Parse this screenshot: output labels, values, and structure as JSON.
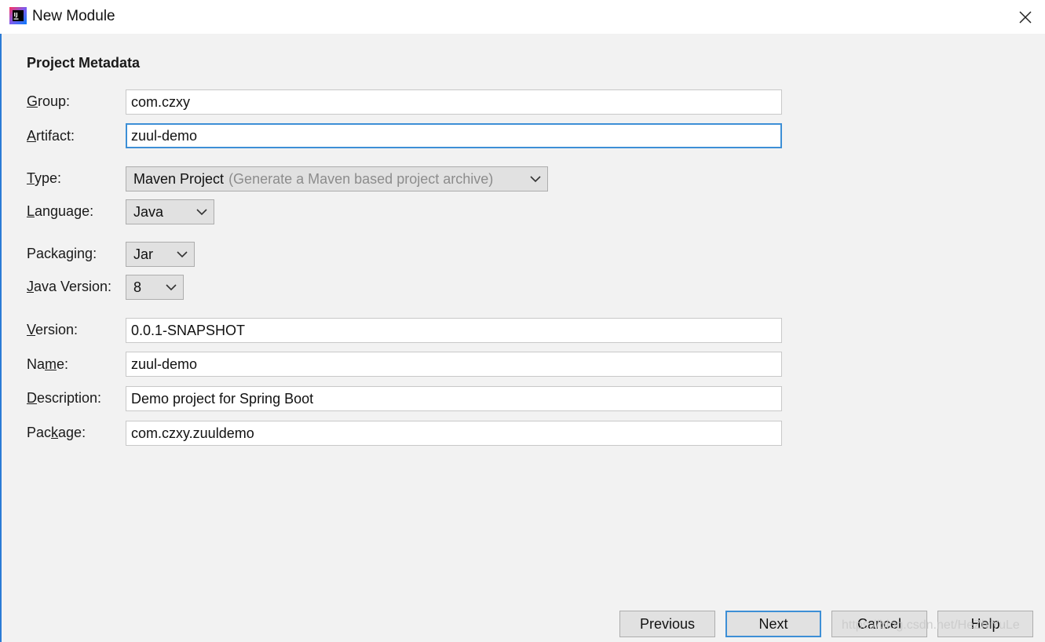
{
  "window": {
    "title": "New Module",
    "icon": "intellij-idea-icon",
    "close_icon": "close-icon"
  },
  "section": {
    "title": "Project Metadata"
  },
  "fields": {
    "group": {
      "label_pre": "",
      "label_mn": "G",
      "label_post": "roup:",
      "value": "com.czxy"
    },
    "artifact": {
      "label_pre": "",
      "label_mn": "A",
      "label_post": "rtifact:",
      "value": "zuul-demo"
    },
    "type": {
      "label_pre": "",
      "label_mn": "T",
      "label_post": "ype:",
      "value": "Maven Project",
      "hint": "(Generate a Maven based project archive)"
    },
    "language": {
      "label_pre": "",
      "label_mn": "L",
      "label_post": "anguage:",
      "value": "Java"
    },
    "packaging": {
      "label_pre": "Packa",
      "label_mn": "g",
      "label_post": "ing:",
      "value": "Jar"
    },
    "java_version": {
      "label_pre": "",
      "label_mn": "J",
      "label_post": "ava Version:",
      "value": "8"
    },
    "version": {
      "label_pre": "",
      "label_mn": "V",
      "label_post": "ersion:",
      "value": "0.0.1-SNAPSHOT"
    },
    "name": {
      "label_pre": "Na",
      "label_mn": "m",
      "label_post": "e:",
      "value": "zuul-demo"
    },
    "description": {
      "label_pre": "",
      "label_mn": "D",
      "label_post": "escription:",
      "value": "Demo project for Spring Boot"
    },
    "package": {
      "label_pre": "Pac",
      "label_mn": "k",
      "label_post": "age:",
      "value": "com.czxy.zuuldemo"
    }
  },
  "buttons": {
    "previous": "Previous",
    "next": "Next",
    "cancel": "Cancel",
    "help": "Help"
  },
  "watermark": "https://blog.csdn.net/HeZhiYuLe",
  "colors": {
    "focus_border": "#3d8fd6",
    "background": "#f2f2f2",
    "button_bg": "#e1e1e1"
  }
}
